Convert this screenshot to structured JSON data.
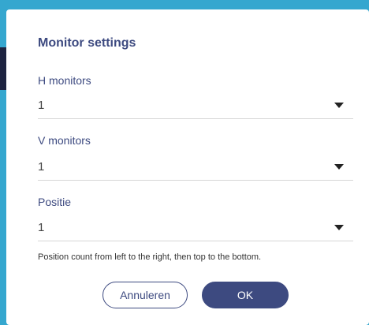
{
  "dialog": {
    "title": "Monitor settings",
    "h_monitors": {
      "label": "H monitors",
      "value": "1",
      "icon": "chevron-down-icon"
    },
    "v_monitors": {
      "label": "V monitors",
      "value": "1",
      "icon": "chevron-down-icon"
    },
    "positie": {
      "label": "Positie",
      "value": "1",
      "icon": "chevron-down-icon"
    },
    "hint": "Position count from left to the right, then top to the bottom.",
    "cancel_label": "Annuleren",
    "ok_label": "OK"
  },
  "colors": {
    "accent": "#3d4a80",
    "backdrop": "#35a7cf",
    "dialog_bg": "#ffffff"
  }
}
